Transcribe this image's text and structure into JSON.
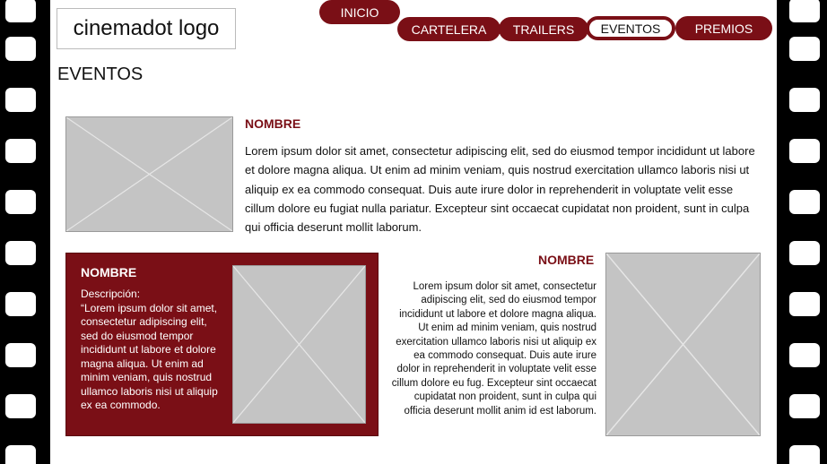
{
  "logo": {
    "text": "cinemadot logo"
  },
  "nav": {
    "items": [
      {
        "label": "INICIO"
      },
      {
        "label": "CARTELERA"
      },
      {
        "label": "TRAILERS"
      },
      {
        "label": "EVENTOS"
      },
      {
        "label": "PREMIOS"
      }
    ],
    "active": "EVENTOS"
  },
  "page_title": "EVENTOS",
  "event_top": {
    "name": "NOMBRE",
    "text": "Lorem ipsum dolor sit amet, consectetur adipiscing elit, sed do eiusmod tempor incididunt ut labore et dolore magna aliqua. Ut enim ad minim veniam, quis nostrud exercitation ullamco laboris nisi ut aliquip ex ea commodo consequat. Duis aute irure dolor in reprehenderit in voluptate velit esse cillum dolore eu fugiat nulla pariatur. Excepteur sint occaecat cupidatat non proident, sunt in culpa qui officia deserunt mollit laborum."
  },
  "event_card": {
    "name": "NOMBRE",
    "desc_label": "Descripción:",
    "desc_text": "“Lorem ipsum dolor sit amet, consectetur adipiscing elit, sed do eiusmod tempor incididunt ut labore et dolore magna aliqua. Ut enim ad minim veniam, quis nostrud ullamco laboris nisi ut aliquip ex ea commodo."
  },
  "event_right": {
    "name": "NOMBRE",
    "text": "Lorem ipsum dolor sit amet, consectetur adipiscing elit, sed do eiusmod tempor incididunt ut labore et dolore magna aliqua. Ut enim ad minim veniam, quis nostrud exercitation ullamco laboris nisi ut aliquip ex ea commodo consequat. Duis aute irure dolor in reprehenderit in voluptate velit esse cillum dolore eu fug. Excepteur sint occaecat cupidatat non proident, sunt in culpa qui officia deserunt mollit anim id est laborum."
  },
  "colors": {
    "brand": "#7a0f16",
    "placeholder": "#c4c4c4"
  }
}
